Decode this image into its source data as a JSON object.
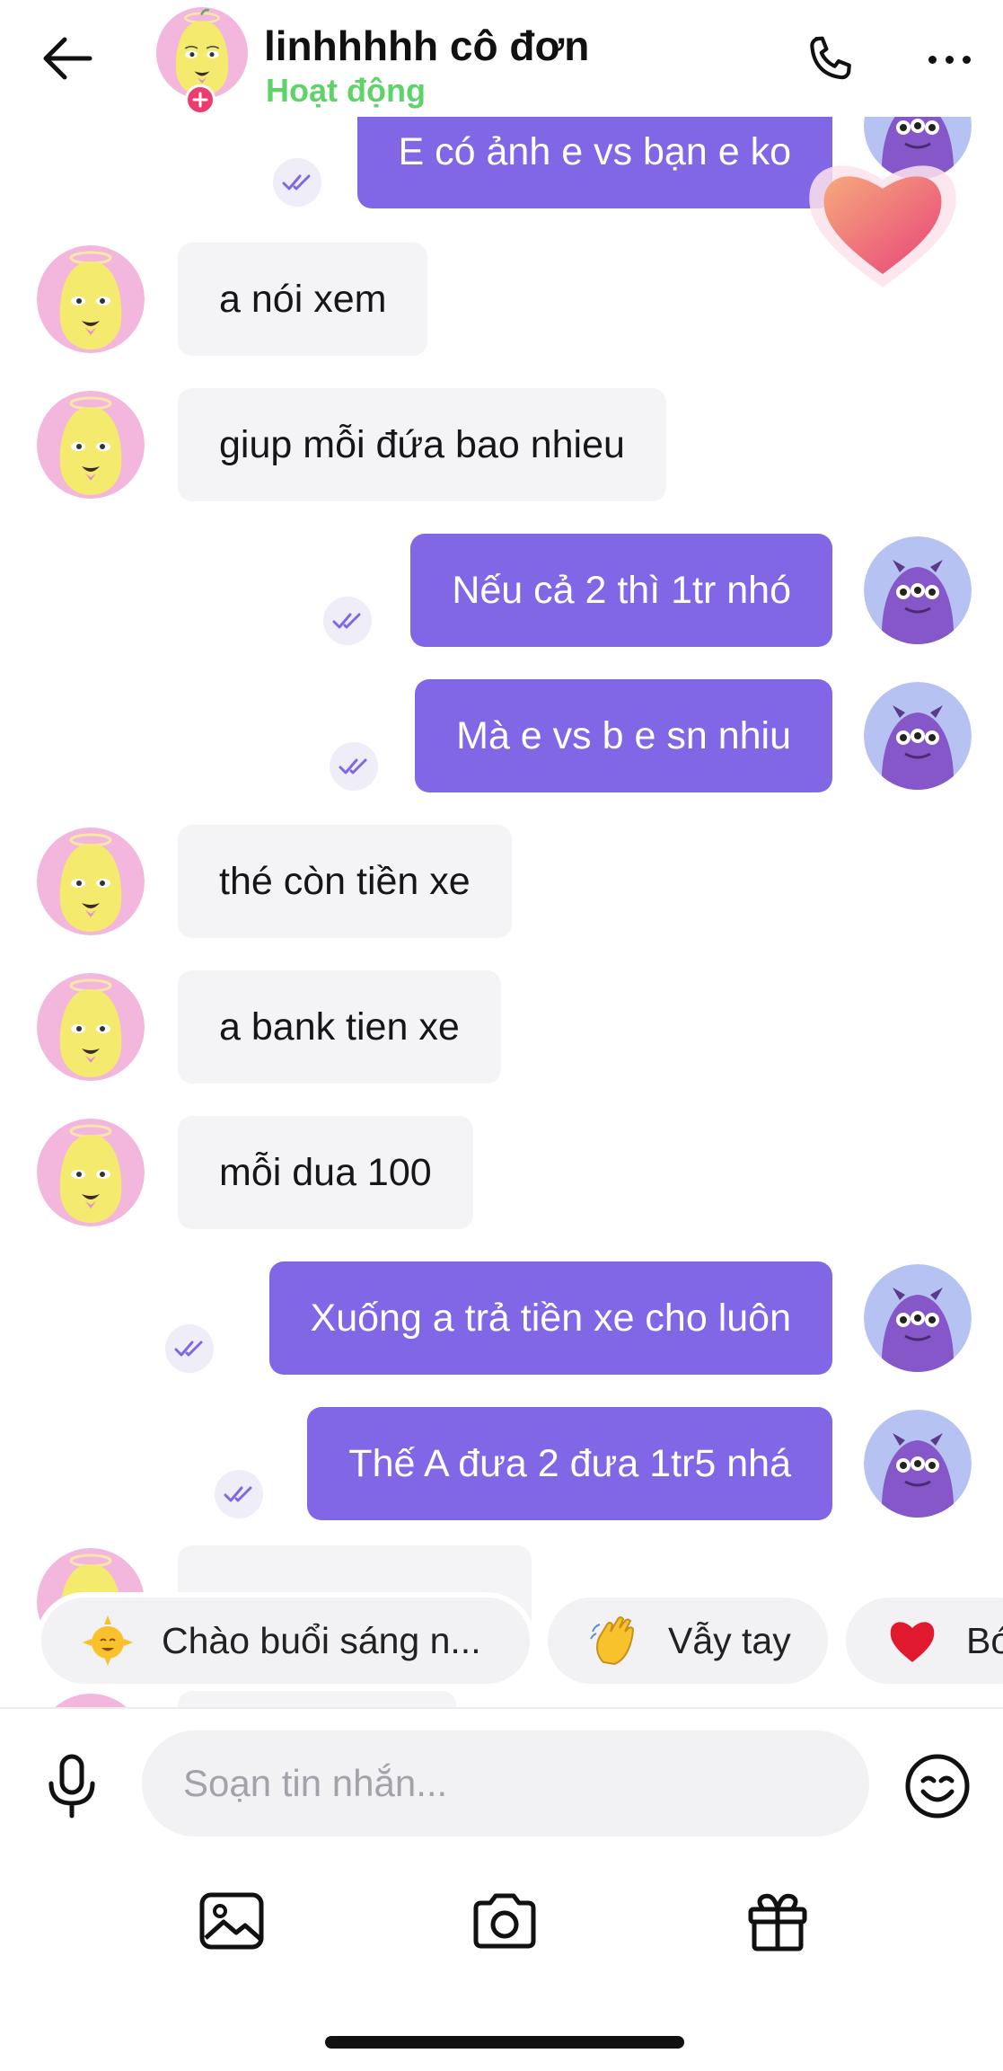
{
  "header": {
    "name": "linhhhhh cô đơn",
    "status": "Hoạt động"
  },
  "messages": [
    {
      "dir": "out",
      "text": "E có ảnh e vs bạn e ko"
    },
    {
      "dir": "in",
      "text": "a nói xem"
    },
    {
      "dir": "in",
      "text": "giup mỗi đứa bao nhieu"
    },
    {
      "dir": "out",
      "text": "Nếu cả 2 thì 1tr nhó"
    },
    {
      "dir": "out",
      "text": "Mà e vs b e sn nhiu"
    },
    {
      "dir": "in",
      "text": "thé còn tiền xe"
    },
    {
      "dir": "in",
      "text": "a bank tien xe"
    },
    {
      "dir": "in",
      "text": "mỗi dua 100"
    },
    {
      "dir": "out",
      "text": "Xuống a trả tiền xe cho luôn"
    },
    {
      "dir": "out",
      "text": "Thế A đưa 2 đưa 1tr5 nhá"
    }
  ],
  "reaction": {
    "icon": "heart-sticker"
  },
  "quick_replies": [
    {
      "label": "Chào buổi sáng n...",
      "icon": "sun-emoji"
    },
    {
      "label": "Vẫy tay",
      "icon": "waving-hand-emoji"
    },
    {
      "label": "Bó",
      "icon": "red-heart-emoji"
    }
  ],
  "composer": {
    "placeholder": "Soạn tin nhắn..."
  },
  "toolbar": {
    "icons": [
      "image-icon",
      "camera-icon",
      "gift-icon"
    ]
  },
  "colors": {
    "outgoing_bubble": "#8167e5",
    "incoming_bubble": "#f4f4f6",
    "status_green": "#5ed36a",
    "badge_pink": "#ec3b6e"
  }
}
